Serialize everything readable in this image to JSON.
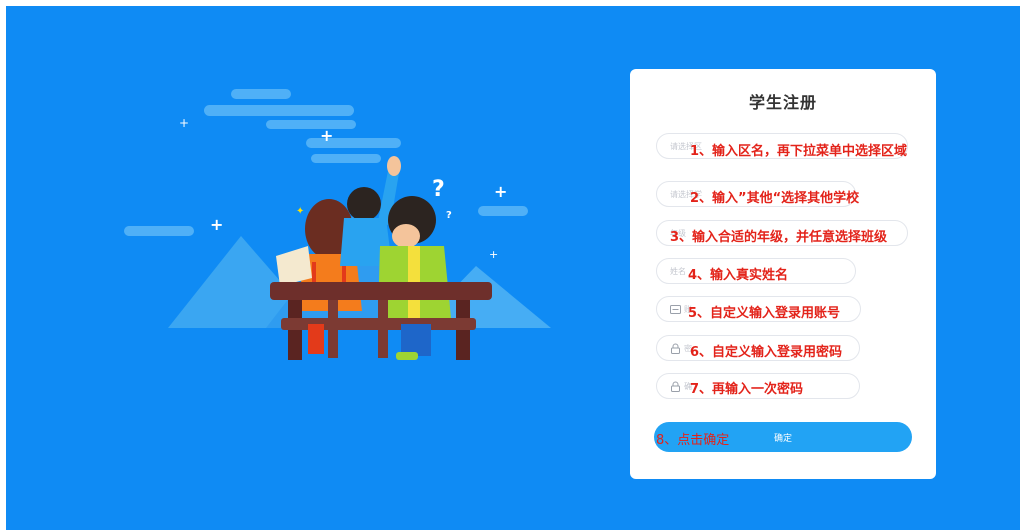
{
  "form": {
    "title": "学生注册",
    "fields": [
      {
        "placeholder": "请选择区",
        "note": "1、输入区名，再下拉菜单中选择区域"
      },
      {
        "placeholder": "请选择学",
        "note": "2、输入”其他“选择其他学校"
      },
      {
        "placeholder": "年级",
        "note": "3、输入合适的年级，并任意选择班级"
      },
      {
        "placeholder": "姓名",
        "note": "4、输入真实姓名"
      },
      {
        "placeholder": "账",
        "note": "5、自定义输入登录用账号"
      },
      {
        "placeholder": "密",
        "note": "6、自定义输入登录用密码"
      },
      {
        "placeholder": "确",
        "note": "7、再输入一次密码"
      }
    ],
    "submit_label": "确定",
    "submit_note": "8、点击确定"
  },
  "icons": {
    "account_field": "id-card-icon",
    "password_field": "lock-icon",
    "confirm_field": "lock-icon"
  },
  "colors": {
    "background": "#0f8bf4",
    "card": "#ffffff",
    "submit": "#22a3f4",
    "annotation": "#e3231a"
  }
}
